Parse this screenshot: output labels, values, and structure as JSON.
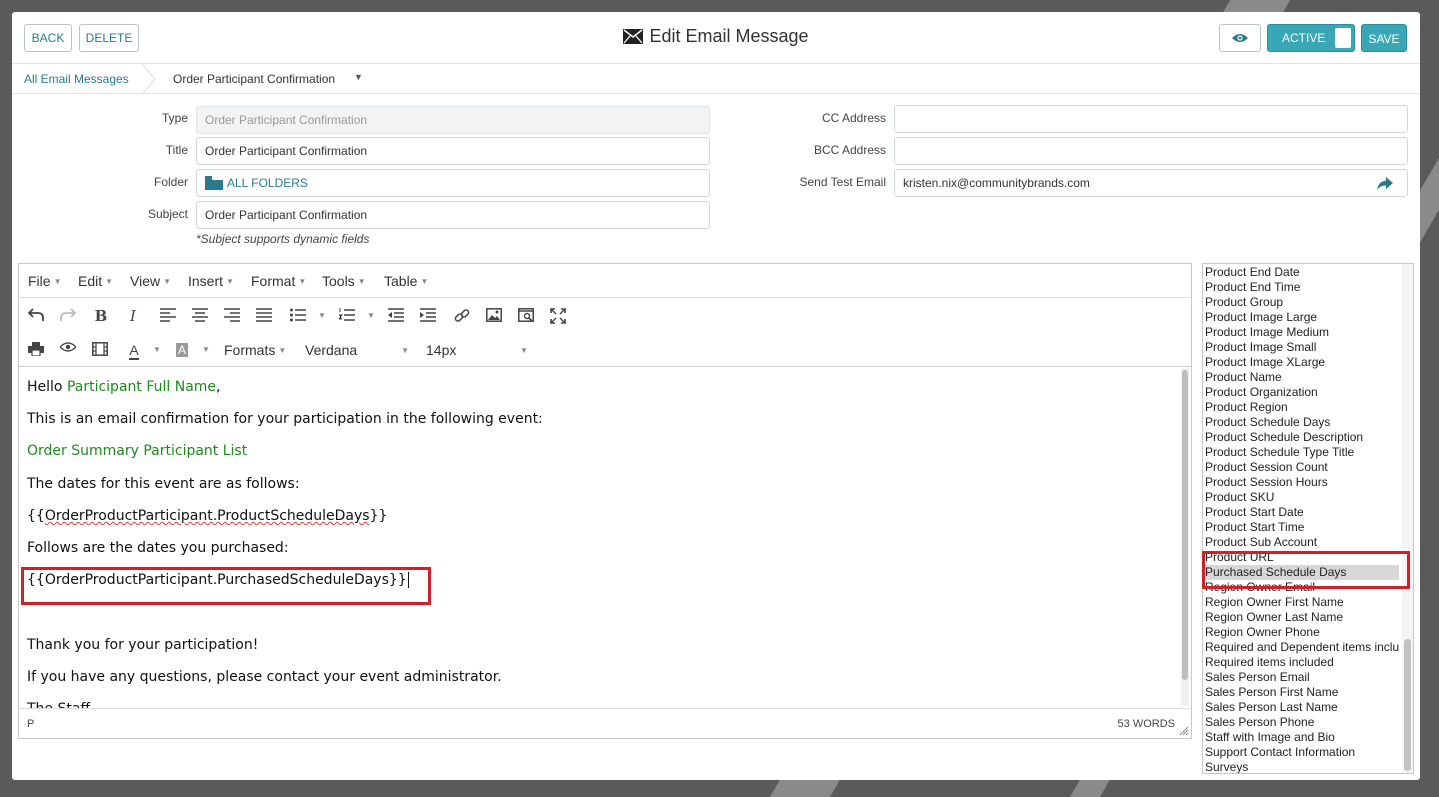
{
  "header": {
    "back_label": "BACK",
    "delete_label": "DELETE",
    "title": "Edit Email Message",
    "toggle_label": "ACTIVE",
    "save_label": "SAVE"
  },
  "breadcrumb": {
    "parent": "All Email Messages",
    "current": "Order Participant Confirmation"
  },
  "form": {
    "type_label": "Type",
    "type_value": "Order Participant Confirmation",
    "title_label": "Title",
    "title_value": "Order Participant Confirmation",
    "folder_label": "Folder",
    "folder_value": "ALL FOLDERS",
    "subject_label": "Subject",
    "subject_value": "Order Participant Confirmation",
    "subject_hint": "*Subject supports dynamic fields",
    "cc_label": "CC Address",
    "cc_value": "",
    "bcc_label": "BCC Address",
    "bcc_value": "",
    "test_label": "Send Test Email",
    "test_value": "kristen.nix@communitybrands.com"
  },
  "editor": {
    "menus": [
      "File",
      "Edit",
      "View",
      "Insert",
      "Format",
      "Tools",
      "Table"
    ],
    "formats_label": "Formats",
    "font_family": "Verdana",
    "font_size": "14px",
    "content": {
      "greeting_prefix": "Hello ",
      "greeting_field": "Participant Full Name",
      "greeting_suffix": ",",
      "line1": "This is an email confirmation for your participation in the following event:",
      "line2": "Order Summary Participant List",
      "line3": "The dates for this event are as follows:",
      "line4_open": "{{",
      "line4_body": "OrderProductParticipant.ProductScheduleDays",
      "line4_close": "}}",
      "line5": "Follows are the dates you purchased:",
      "line6": "{{OrderProductParticipant.PurchasedScheduleDays}}",
      "line7": "Thank you for your participation!",
      "line8": "If you have any questions, please contact your event administrator.",
      "line9": "The Staff"
    },
    "status_path": "P",
    "word_count": "53 WORDS"
  },
  "field_list": {
    "items": [
      "Product End Date",
      "Product End Time",
      "Product Group",
      "Product Image Large",
      "Product Image Medium",
      "Product Image Small",
      "Product Image XLarge",
      "Product Name",
      "Product Organization",
      "Product Region",
      "Product Schedule Days",
      "Product Schedule Description",
      "Product Schedule Type Title",
      "Product Session Count",
      "Product Session Hours",
      "Product SKU",
      "Product Start Date",
      "Product Start Time",
      "Product Sub Account",
      "Product URL",
      "Purchased Schedule Days",
      "Region Owner Email",
      "Region Owner First Name",
      "Region Owner Last Name",
      "Region Owner Phone",
      "Required and Dependent items included",
      "Required items included",
      "Sales Person Email",
      "Sales Person First Name",
      "Sales Person Last Name",
      "Sales Person Phone",
      "Staff with Image and Bio",
      "Support Contact Information",
      "Surveys"
    ],
    "selected": "Purchased Schedule Days"
  },
  "colors": {
    "accent": "#3aa7b6",
    "link": "#2a7a8c",
    "dynamic_field": "#1d8a1d",
    "highlight": "#d0202a"
  }
}
